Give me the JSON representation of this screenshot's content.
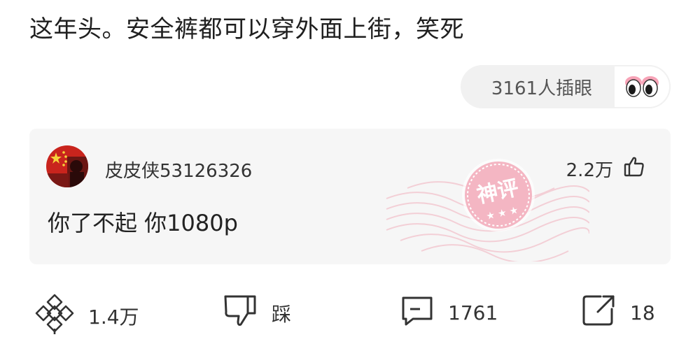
{
  "post": {
    "text": "这年头。安全裤都可以穿外面上街，笑死"
  },
  "peek": {
    "label": "3161人插眼"
  },
  "comment": {
    "username": "皮皮侠53126326",
    "likes": "2.2万",
    "text": "你了不起 你1080p",
    "badge": "神评"
  },
  "actions": {
    "share_like": "1.4万",
    "dislike": "踩",
    "comments": "1761",
    "shares": "18"
  },
  "colors": {
    "badge": "#f0a8b8",
    "eye_pink": "#f7a3b7"
  }
}
